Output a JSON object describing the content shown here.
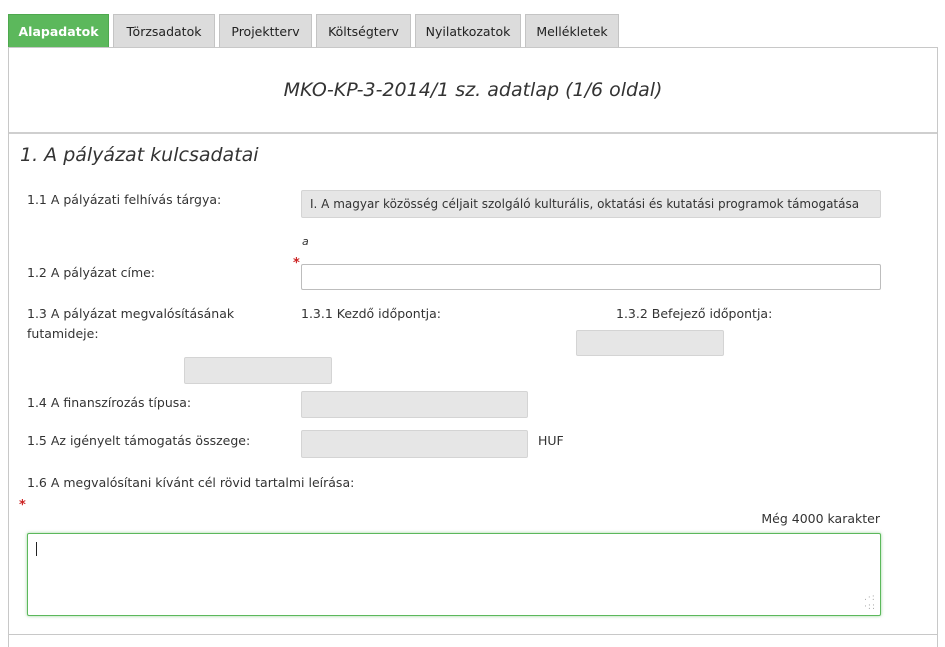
{
  "tabs": [
    {
      "label": "Alapadatok",
      "active": true
    },
    {
      "label": "Törzsadatok",
      "active": false
    },
    {
      "label": "Projektterv",
      "active": false
    },
    {
      "label": "Költségterv",
      "active": false
    },
    {
      "label": "Nyilatkozatok",
      "active": false
    },
    {
      "label": "Mellékletek",
      "active": false
    }
  ],
  "form_title": "MKO-KP-3-2014/1 sz. adatlap (1/6 oldal)",
  "section_title": "1. A pályázat kulcsadatai",
  "fields": {
    "subject": {
      "label": "1.1 A pályázati felhívás tárgya:",
      "value": "I. A magyar közösség céljait szolgáló kulturális, oktatási és kutatási programok támogatása",
      "note": "a"
    },
    "title": {
      "label": "1.2 A pályázat címe:",
      "value": "",
      "required_mark": "*"
    },
    "duration": {
      "label": "1.3 A pályázat megvalósításának futamideje:",
      "start_label": "1.3.1 Kezdő időpontja:",
      "end_label": "1.3.2 Befejező időpontja:",
      "start_value": "",
      "end_value": ""
    },
    "financing_type": {
      "label": "1.4 A finanszírozás típusa:",
      "value": ""
    },
    "amount": {
      "label": "1.5 Az igényelt támogatás összege:",
      "value": "",
      "unit": "HUF"
    },
    "description": {
      "label": "1.6 A megvalósítani kívánt cél rövid tartalmi leírása:",
      "required_mark": "*",
      "counter": "Még 4000 karakter",
      "value": ""
    }
  },
  "colors": {
    "active_tab": "#5cb85c",
    "required": "#cc2222",
    "readonly_bg": "#e6e6e6"
  }
}
